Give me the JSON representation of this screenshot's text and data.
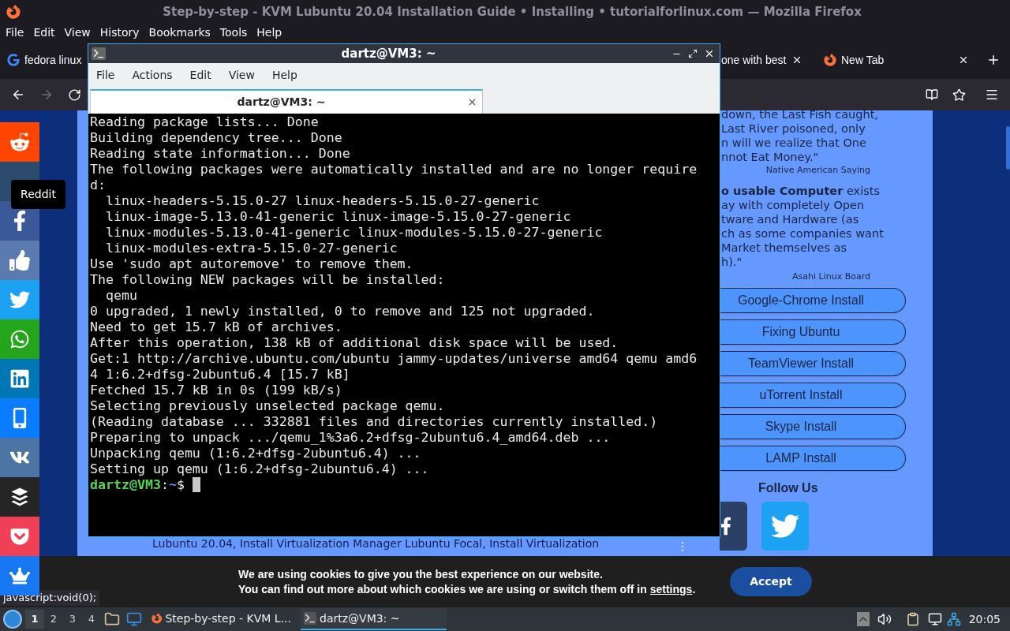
{
  "browser": {
    "title": "Step-by-step - KVM Lubuntu 20.04 Installation Guide • Installing • tutorialforlinux.com — Mozilla Firefox",
    "menu": [
      "File",
      "Edit",
      "View",
      "History",
      "Bookmarks",
      "Tools",
      "Help"
    ],
    "tabs": [
      {
        "label": "fedora linux",
        "kind": "google",
        "selected": false
      },
      {
        "label": "one with best",
        "kind": "plain",
        "selected": false
      },
      {
        "label": "New Tab",
        "kind": "firefox",
        "selected": false
      }
    ],
    "status_text": "javascript:void(0);"
  },
  "social": [
    {
      "kind": "reddit",
      "color": "#ff4500"
    },
    {
      "kind": "blank",
      "color": "#2c4a6b"
    },
    {
      "kind": "facebook",
      "color": "#3b5998"
    },
    {
      "kind": "like",
      "color": "#5b7bb0"
    },
    {
      "kind": "twitter",
      "color": "#1da1f2"
    },
    {
      "kind": "whatsapp",
      "color": "#25a51c"
    },
    {
      "kind": "linkedin",
      "color": "#0077b5"
    },
    {
      "kind": "sms",
      "color": "#0a7cff"
    },
    {
      "kind": "vk",
      "color": "#4c75a3"
    },
    {
      "kind": "buffer",
      "color": "#252525"
    },
    {
      "kind": "pocket",
      "color": "#ef4056"
    },
    {
      "kind": "crown",
      "color": "#1877f2"
    }
  ],
  "tooltip": "Reddit",
  "page": {
    "quote_1": {
      "lines": [
        "down, the Last Fish caught,",
        "Last River poisoned, only",
        "n will we realize that One",
        "nnot Eat Money.\""
      ],
      "source": "Native American Saying"
    },
    "quote_2": {
      "lines": [
        "**o usable Computer** exists",
        "ay with completely Open",
        "tware and Hardware (as",
        "ch as some companies want",
        "Market themselves as",
        "h).\""
      ],
      "source": "Asahi Linux Board"
    },
    "links": [
      "Google-Chrome Install",
      "Fixing Ubuntu",
      "TeamViewer Install",
      "uTorrent Install",
      "Skype Install",
      "LAMP Install"
    ],
    "follow_title": "Follow Us",
    "footer_text": "Lubuntu 20.04, Install Virtualization Manager Lubuntu Focal, Install Virtualization"
  },
  "cookie": {
    "line_1": "We are using cookies to give you the best experience on our website.",
    "line_2": "You can find out more about which cookies we are using or switch them off in ",
    "link": "settings",
    "line_2_end": ".",
    "button": "Accept"
  },
  "terminal": {
    "title": "dartz@VM3: ~",
    "menu": [
      "File",
      "Actions",
      "Edit",
      "View",
      "Help"
    ],
    "tab": "dartz@VM3: ~",
    "lines": [
      "Reading package lists... Done",
      "Building dependency tree... Done",
      "Reading state information... Done",
      "The following packages were automatically installed and are no longer require",
      "d:",
      "  linux-headers-5.15.0-27 linux-headers-5.15.0-27-generic",
      "  linux-image-5.13.0-41-generic linux-image-5.15.0-27-generic",
      "  linux-modules-5.13.0-41-generic linux-modules-5.15.0-27-generic",
      "  linux-modules-extra-5.15.0-27-generic",
      "Use 'sudo apt autoremove' to remove them.",
      "The following NEW packages will be installed:",
      "  qemu",
      "0 upgraded, 1 newly installed, 0 to remove and 125 not upgraded.",
      "Need to get 15.7 kB of archives.",
      "After this operation, 138 kB of additional disk space will be used.",
      "Get:1 http://archive.ubuntu.com/ubuntu jammy-updates/universe amd64 qemu amd6",
      "4 1:6.2+dfsg-2ubuntu6.4 [15.7 kB]",
      "Fetched 15.7 kB in 0s (199 kB/s)",
      "Selecting previously unselected package qemu.",
      "(Reading database ... 332881 files and directories currently installed.)",
      "Preparing to unpack .../qemu_1%3a6.2+dfsg-2ubuntu6.4_amd64.deb ...",
      "Unpacking qemu (1:6.2+dfsg-2ubuntu6.4) ...",
      "Setting up qemu (1:6.2+dfsg-2ubuntu6.4) ..."
    ],
    "prompt": {
      "user_host": "dartz@VM3",
      "separator": ":",
      "path": "~",
      "symbol": "$"
    }
  },
  "taskbar": {
    "workspaces": [
      {
        "label": "1",
        "selected": true
      },
      {
        "label": "2",
        "selected": false
      },
      {
        "label": "3",
        "selected": false
      },
      {
        "label": "4",
        "selected": false
      }
    ],
    "tasks": [
      {
        "label": "Step-by-step - KVM L...",
        "kind": "firefox",
        "selected": false
      },
      {
        "label": "dartz@VM3: ~",
        "kind": "terminal",
        "selected": true
      }
    ],
    "clock": "20:05"
  }
}
